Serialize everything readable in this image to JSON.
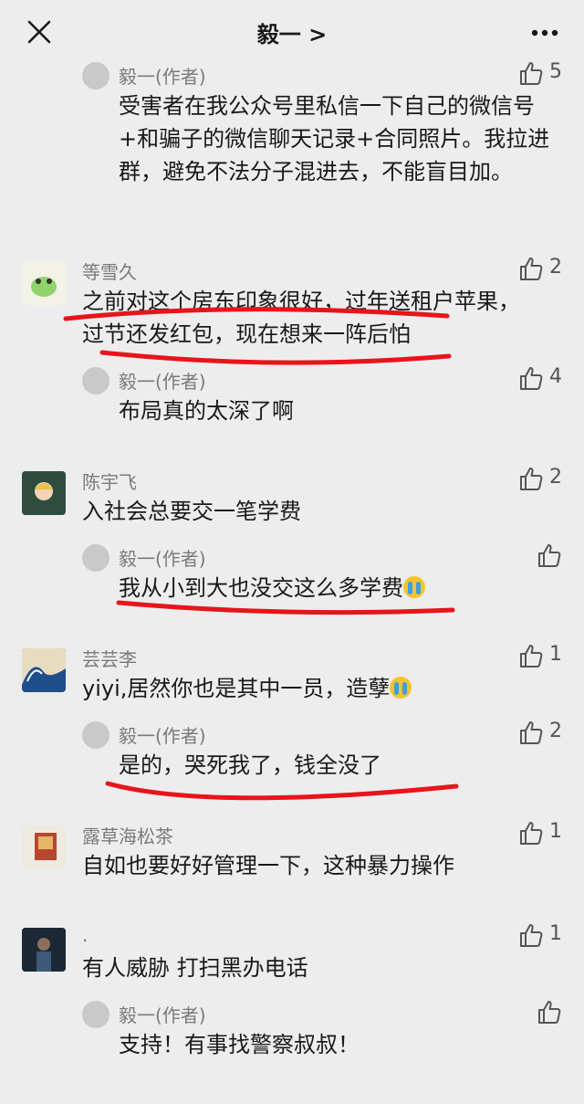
{
  "header": {
    "title": "毅一 >"
  },
  "icons": {
    "close": "close-icon",
    "more": "more-icon",
    "like": "thumbs-up-icon",
    "cry": "crying-emoji-icon"
  },
  "colors": {
    "highlight": "#e8141c"
  },
  "comments": [
    {
      "name": "",
      "text": "",
      "likes": "",
      "replies": [
        {
          "name": "毅一(作者)",
          "text": "受害者在我公众号里私信一下自己的微信号+和骗子的微信聊天记录+合同照片。我拉进群，避免不法分子混进去，不能盲目加。",
          "likes": "5"
        }
      ]
    },
    {
      "name": "等雪久",
      "text": "之前对这个房东印象很好，过年送租户苹果，过节还发红包，现在想来一阵后怕",
      "likes": "2",
      "replies": [
        {
          "name": "毅一(作者)",
          "text": "布局真的太深了啊",
          "likes": "4"
        }
      ]
    },
    {
      "name": "陈宇飞",
      "text": "入社会总要交一笔学费",
      "likes": "2",
      "replies": [
        {
          "name": "毅一(作者)",
          "text": "我从小到大也没交这么多学费",
          "likes": ""
        }
      ]
    },
    {
      "name": "芸芸李",
      "text": "yiyi,居然你也是其中一员，造孽",
      "likes": "1",
      "replies": [
        {
          "name": "毅一(作者)",
          "text": "是的，哭死我了，钱全没了",
          "likes": "2"
        }
      ]
    },
    {
      "name": "露草海松茶",
      "text": "自如也要好好管理一下，这种暴力操作",
      "likes": "1",
      "replies": []
    },
    {
      "name": ".",
      "text": "有人威胁 打扫黑办电话",
      "likes": "1",
      "replies": [
        {
          "name": "毅一(作者)",
          "text": "支持！有事找警察叔叔！",
          "likes": ""
        }
      ]
    }
  ]
}
